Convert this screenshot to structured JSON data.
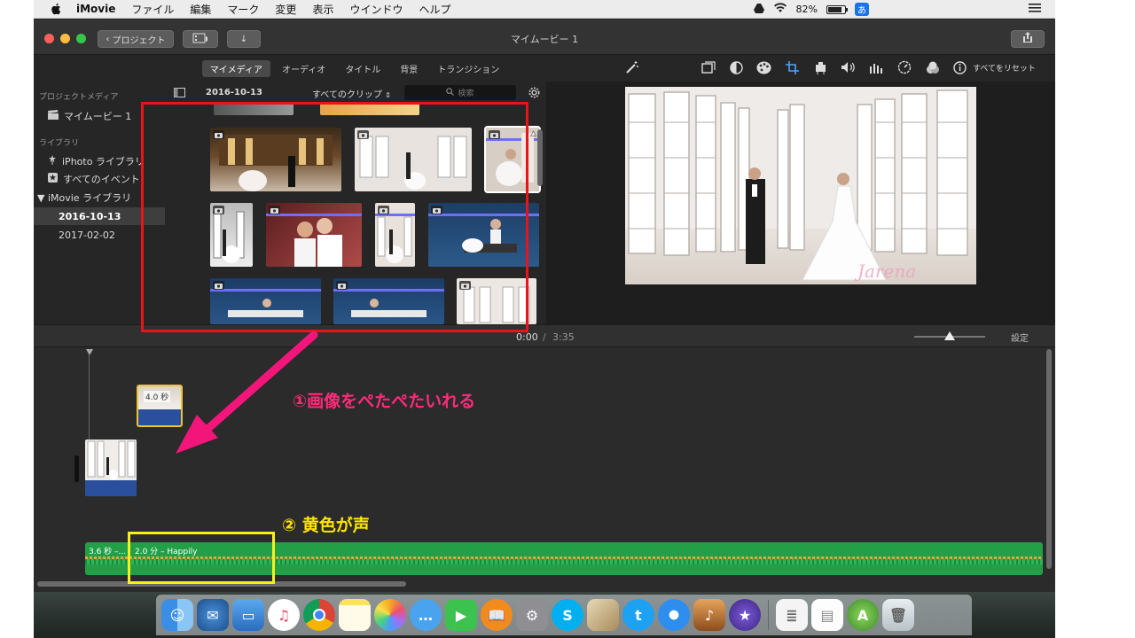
{
  "menubar": {
    "app_name": "iMovie",
    "items": [
      "ファイル",
      "編集",
      "マーク",
      "変更",
      "表示",
      "ウインドウ",
      "ヘルプ"
    ],
    "battery_percent": "82%",
    "battery_level": 0.82,
    "ime_label": "あ",
    "icons": [
      "apple-icon",
      "drive-icon",
      "wifi-icon",
      "battery-icon",
      "ime-icon",
      "list-icon"
    ]
  },
  "titlebar": {
    "back_label": "プロジェクト",
    "window_title": "マイムービー 1"
  },
  "media_tabs": [
    {
      "label": "マイメディア",
      "active": true
    },
    {
      "label": "オーディオ",
      "active": false
    },
    {
      "label": "タイトル",
      "active": false
    },
    {
      "label": "背景",
      "active": false
    },
    {
      "label": "トランジション",
      "active": false
    }
  ],
  "sidebar": {
    "project_media_heading": "プロジェクトメディア",
    "project_item": "マイムービー 1",
    "library_heading": "ライブラリ",
    "items": [
      {
        "label": "iPhoto ライブラリ",
        "icon": "iphoto-icon"
      },
      {
        "label": "すべてのイベント",
        "icon": "star-icon"
      },
      {
        "label": "▼ iMovie ライブラリ",
        "icon": ""
      },
      {
        "label": "2016-10-13",
        "selected": true
      },
      {
        "label": "2017-02-02",
        "selected": false
      }
    ]
  },
  "browser": {
    "event_title": "2016-10-13",
    "filter_label": "すべてのクリップ",
    "search_placeholder": "検索"
  },
  "viewer": {
    "reset_label": "すべてをリセット",
    "watermark": "Jarena"
  },
  "timeline": {
    "current_time": "0:00",
    "separator": "/",
    "total_time": "3:35",
    "settings_label": "設定",
    "zoom_level": 0.5,
    "photo_clip_duration": "4.0 秒",
    "audio_clip_1": "3.6 秒 –...",
    "audio_clip_2": "2.0 分 – Happily"
  },
  "annotations": {
    "step1": "①画像をぺたぺたいれる",
    "step2": "② 黄色が声"
  },
  "dock": {
    "apps": [
      "finder-icon",
      "thunderbird-icon",
      "mission-control-icon",
      "music-icon",
      "chrome-icon",
      "notes-icon",
      "photos-icon",
      "messages-icon",
      "facetime-icon",
      "books-icon",
      "system-preferences-icon",
      "skype-icon",
      "preview-icon",
      "twitter-icon",
      "safari-icon",
      "garageband-icon",
      "imovie-icon",
      "document-icon",
      "file-icon",
      "android-studio-icon",
      "trash-icon"
    ]
  },
  "colors": {
    "annotation_red": "#e8141b",
    "annotation_yellow": "#f7f01a",
    "annotation_pink": "#ff2a7a",
    "audio_green": "#23a047",
    "clip_blue": "#2a4f9c"
  }
}
